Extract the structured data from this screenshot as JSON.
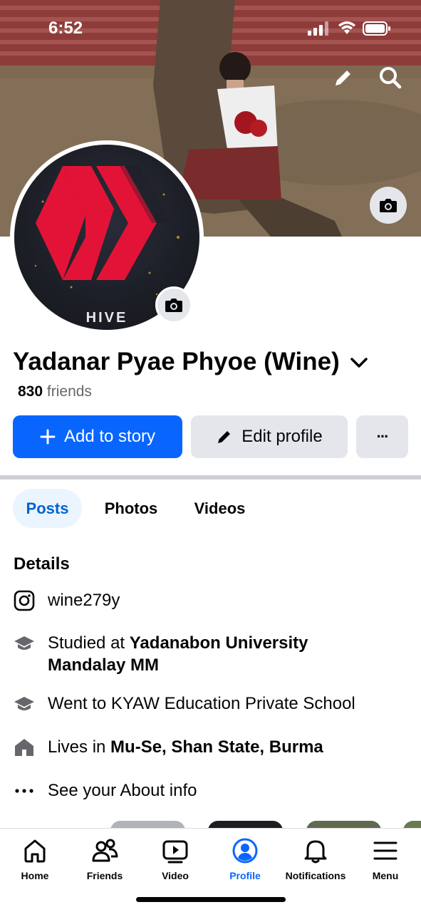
{
  "status_bar": {
    "time": "6:52"
  },
  "cover": {
    "edit_icon": "pencil-icon",
    "search_icon": "search-icon",
    "camera_icon": "camera-icon"
  },
  "avatar": {
    "logo_text": "HIVE",
    "camera_icon": "camera-icon"
  },
  "profile": {
    "name": "Yadanar Pyae Phyoe (Wine)",
    "friends_count": "830",
    "friends_label": "friends"
  },
  "actions": {
    "add_story": "Add to story",
    "edit_profile": "Edit profile",
    "more": "···"
  },
  "tabs": [
    {
      "label": "Posts",
      "active": true
    },
    {
      "label": "Photos",
      "active": false
    },
    {
      "label": "Videos",
      "active": false
    }
  ],
  "details": {
    "title": "Details",
    "instagram": "wine279y",
    "studied_prefix": "Studied at ",
    "studied_place_line1": "Yadanabon University",
    "studied_place_line2": "Mandalay MM",
    "school": "Went to KYAW Education Private School",
    "lives_prefix": "Lives in ",
    "lives_place": "Mu-Se, Shan State, Burma",
    "about": "See your About info"
  },
  "nav": [
    {
      "label": "Home",
      "icon": "home-icon",
      "active": false
    },
    {
      "label": "Friends",
      "icon": "friends-icon",
      "active": false
    },
    {
      "label": "Video",
      "icon": "video-icon",
      "active": false
    },
    {
      "label": "Profile",
      "icon": "profile-icon",
      "active": true
    },
    {
      "label": "Notifications",
      "icon": "bell-icon",
      "active": false
    },
    {
      "label": "Menu",
      "icon": "menu-icon",
      "active": false
    }
  ],
  "colors": {
    "accent": "#0866ff",
    "tab_active_bg": "#ebf5ff",
    "secondary_btn": "#e4e6eb",
    "muted_text": "#65676b"
  }
}
